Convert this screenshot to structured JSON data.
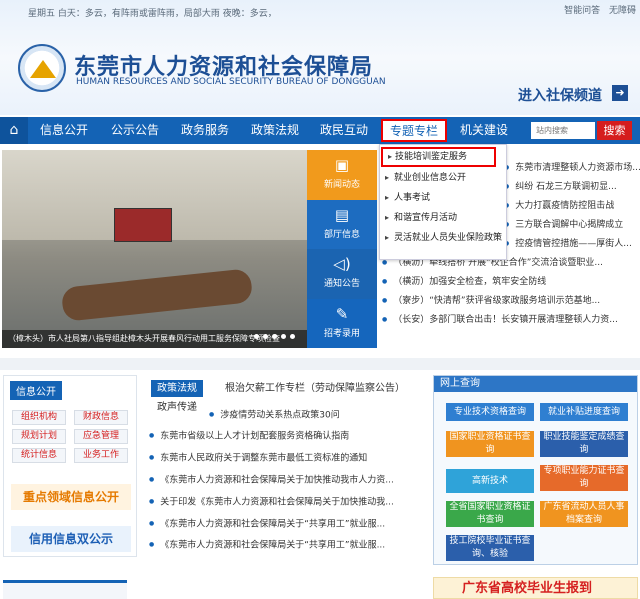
{
  "header": {
    "weather": "星期五 白天：多云，有阵雨或雷阵雨，局部大雨 夜晚：多云，",
    "toplinks": [
      "智能问答",
      "无障碍"
    ],
    "title_cn": "东莞市人力资源和社会保障局",
    "title_en": "HUMAN RESOURCES AND SOCIAL SECURITY BUREAU OF DONGGUAN",
    "enter_label": "进入社保频道"
  },
  "nav": {
    "items": [
      "信息公开",
      "公示公告",
      "政务服务",
      "政策法规",
      "政民互动",
      "专题专栏",
      "机关建设"
    ],
    "search_placeholder": "站内搜索",
    "search_button": "搜索"
  },
  "dropdown": {
    "items": [
      "技能培训鉴定服务",
      "就业创业信息公开",
      "人事考试",
      "和谐宣传月活动",
      "灵活就业人员失业保险政策"
    ]
  },
  "slide": {
    "caption": "（樟木头）市人社局第八指导组赴樟木头开展春风行动用工服务保障专项检查"
  },
  "tiles": [
    "新闻动态",
    "部厅信息",
    "通知公告",
    "招考录用"
  ],
  "news": [
    "东莞市清理整顿人力资源市场...",
    "纠纷 石龙三方联调初显...",
    "大力打赢疫情防控阻击战",
    "三方联合调解中心揭牌成立",
    "控疫情管控措施——厚街人...",
    "（横沥）牵线搭桥 开展“校企合作”交流洽谈暨职业...",
    "（横沥）加强安全检查，筑牢安全防线",
    "（寮步）“快清帮”获评省级家政服务培训示范基地...",
    "（长安）多部门联合出击！长安镇开展清理整顿人力资..."
  ],
  "info": {
    "header": "信息公开",
    "buttons": [
      "组织机构",
      "财政信息",
      "规划计划",
      "应急管理",
      "统计信息",
      "业务工作"
    ],
    "banner1": "重点领域信息公开",
    "banner2": "信用信息双公示"
  },
  "policy": {
    "tabs": [
      "政策法规",
      "根治欠薪工作专栏（劳动保障监察公告）",
      "政声传递"
    ],
    "rows": [
      "涉疫情劳动关系热点政策30问",
      "东莞市省级以上人才计划配套服务资格确认指南",
      "东莞市人民政府关于调整东莞市最低工资标准的通知",
      "《东莞市人力资源和社会保障局关于加快推动我市人力资...",
      "关于印发《东莞市人力资源和社会保障局关于加快推动我...",
      "《东莞市人力资源和社会保障局关于“共享用工”就业服...",
      "《东莞市人力资源和社会保障局关于“共享用工”就业服..."
    ]
  },
  "query": {
    "header": "网上查询",
    "items": [
      "专业技术资格查询",
      "就业补贴进度查询",
      "国家职业资格证书查询",
      "职业技能鉴定成绩查询",
      "高新技术",
      "专项职业能力证书查询",
      "全省国家职业资格证书查询",
      "广东省流动人员人事档案查询",
      "技工院校毕业证书查询、核验"
    ],
    "colors": [
      "#2f7fd1",
      "#2f7fd1",
      "#f0941f",
      "#2b5fab",
      "#2fa3d9",
      "#e66a2a",
      "#3aa84a",
      "#f0941f",
      "#2b5fab"
    ]
  },
  "footer_banner": "广东省高校毕业生报到"
}
